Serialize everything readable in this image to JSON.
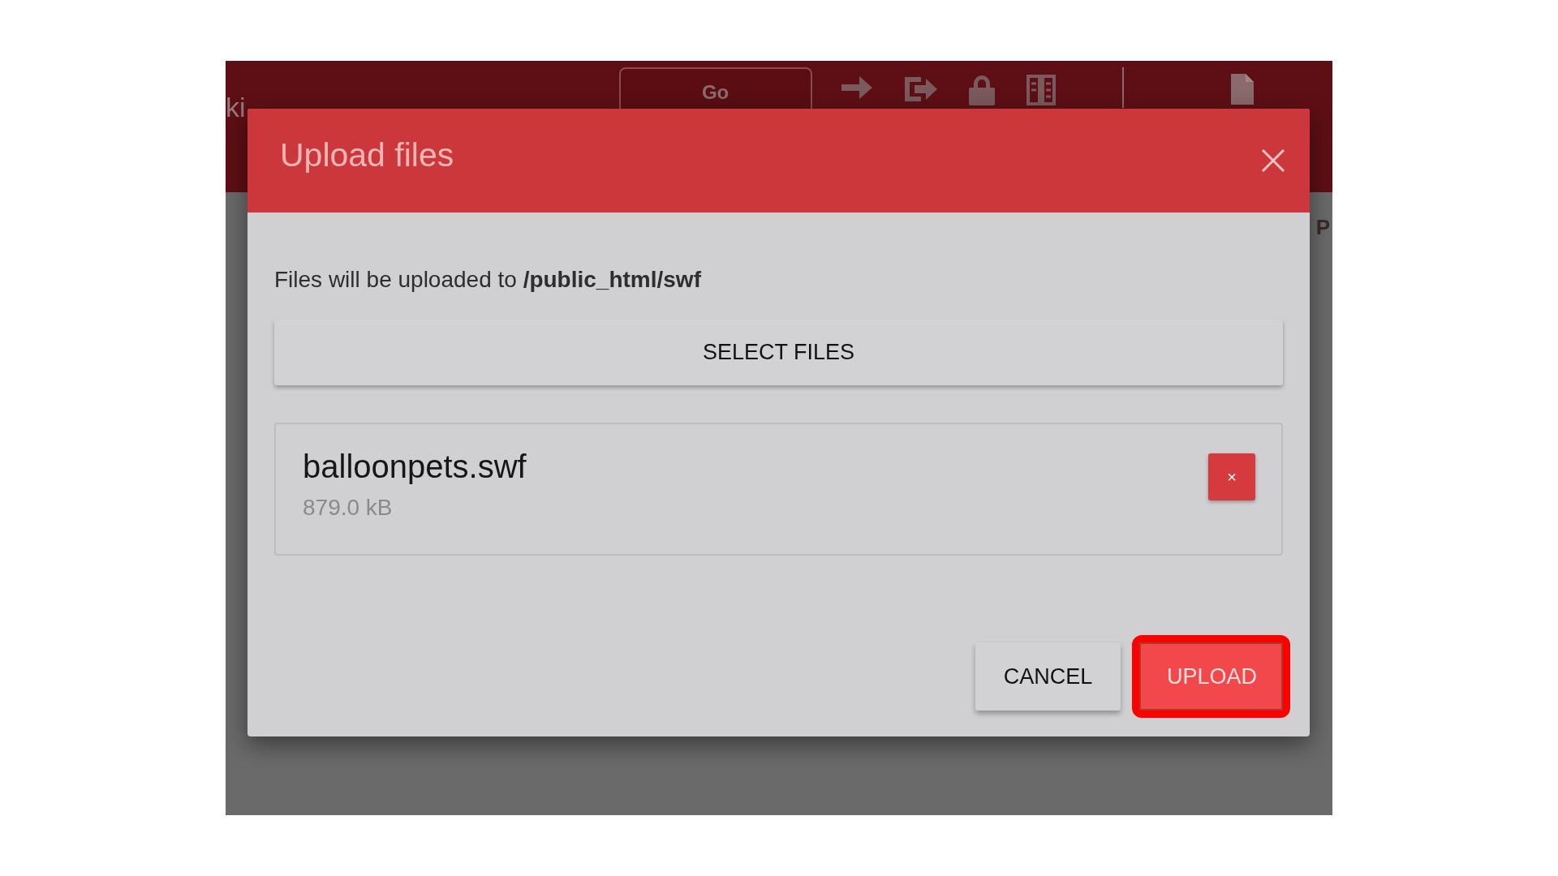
{
  "background": {
    "left_text": "ki",
    "go_button": "Go",
    "right_text": "P"
  },
  "dialog": {
    "title": "Upload files",
    "destination_text": "Files will be uploaded to **/public_html/swf**",
    "select_button": "SELECT FILES",
    "files": [
      {
        "name": "balloonpets.swf",
        "size": "879.0 kB",
        "remove_label": "×"
      }
    ],
    "buttons": [
      {
        "label": "CANCEL",
        "kind": "secondary",
        "highlighted": false
      },
      {
        "label": "UPLOAD",
        "kind": "primary",
        "highlighted": true
      }
    ]
  }
}
